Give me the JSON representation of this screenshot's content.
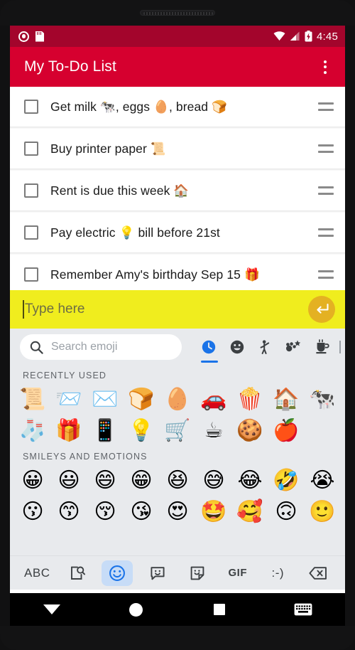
{
  "status_bar": {
    "icons": [
      "record-icon",
      "sd-card-icon",
      "wifi-icon",
      "cellular-signal-icon",
      "battery-charging-icon"
    ],
    "time": "4:45"
  },
  "app_bar": {
    "title": "My To-Do List",
    "overflow_label": "More options",
    "background": "#D6002F",
    "status_background": "#A3052C"
  },
  "todo_list": {
    "items": [
      {
        "text": "Get milk 🐄, eggs 🥚, bread 🍞",
        "checked": false
      },
      {
        "text": "Buy printer paper 📜",
        "checked": false
      },
      {
        "text": "Rent is due this week 🏠",
        "checked": false
      },
      {
        "text": "Pay electric 💡 bill before 21st",
        "checked": false
      },
      {
        "text": "Remember Amy's birthday Sep 15 🎁",
        "checked": false
      }
    ]
  },
  "compose": {
    "placeholder": "Type here",
    "value": "",
    "send_icon": "enter-arrow-icon",
    "background": "#F0ED1E",
    "send_color": "#E4B122"
  },
  "keyboard": {
    "search": {
      "placeholder": "Search emoji",
      "icon": "search-icon"
    },
    "categories": [
      {
        "name": "recent",
        "icon": "clock-icon",
        "selected": true
      },
      {
        "name": "smileys",
        "icon": "smiley-icon",
        "selected": false
      },
      {
        "name": "people",
        "icon": "person-waving-icon",
        "selected": false
      },
      {
        "name": "nature",
        "icon": "animals-nature-icon",
        "selected": false
      },
      {
        "name": "food",
        "icon": "food-drink-icon",
        "selected": false
      }
    ],
    "accent": "#1A73E8",
    "sections": [
      {
        "label": "RECENTLY USED",
        "rows": [
          [
            "📜",
            "📨",
            "✉️",
            "🍞",
            "🥚",
            "🚗",
            "🍿",
            "🏠",
            "🐄"
          ],
          [
            "🧦",
            "🎁",
            "📱",
            "💡",
            "🛒",
            "☕",
            "🍪",
            "🍎"
          ]
        ]
      },
      {
        "label": "SMILEYS AND EMOTIONS",
        "rows": [
          [
            "😀",
            "😃",
            "😄",
            "😁",
            "😆",
            "😅",
            "😂",
            "🤣",
            "😭"
          ],
          [
            "😗",
            "😙",
            "😚",
            "😘",
            "😍",
            "🤩",
            "🥰",
            "🙃",
            "🙂"
          ]
        ]
      }
    ],
    "toolbar": [
      {
        "name": "abc-key",
        "label": "ABC",
        "icon": "",
        "selected": false
      },
      {
        "name": "image-search-key",
        "label": "",
        "icon": "image-search-icon",
        "selected": false
      },
      {
        "name": "emoji-key",
        "label": "",
        "icon": "smiley-icon",
        "selected": true
      },
      {
        "name": "emoji-kitchen-key",
        "label": "",
        "icon": "emoji-bubble-icon",
        "selected": false
      },
      {
        "name": "sticker-key",
        "label": "",
        "icon": "sticker-icon",
        "selected": false
      },
      {
        "name": "gif-key",
        "label": "GIF",
        "icon": "",
        "selected": false
      },
      {
        "name": "emoticon-key",
        "label": ":-)",
        "icon": "",
        "selected": false
      },
      {
        "name": "backspace-key",
        "label": "",
        "icon": "backspace-icon",
        "selected": false
      }
    ]
  },
  "nav_bar": {
    "buttons": [
      {
        "name": "back-button",
        "icon": "down-triangle-icon"
      },
      {
        "name": "home-button",
        "icon": "circle-icon"
      },
      {
        "name": "recents-button",
        "icon": "square-icon"
      },
      {
        "name": "ime-switcher-button",
        "icon": "keyboard-icon"
      }
    ]
  }
}
